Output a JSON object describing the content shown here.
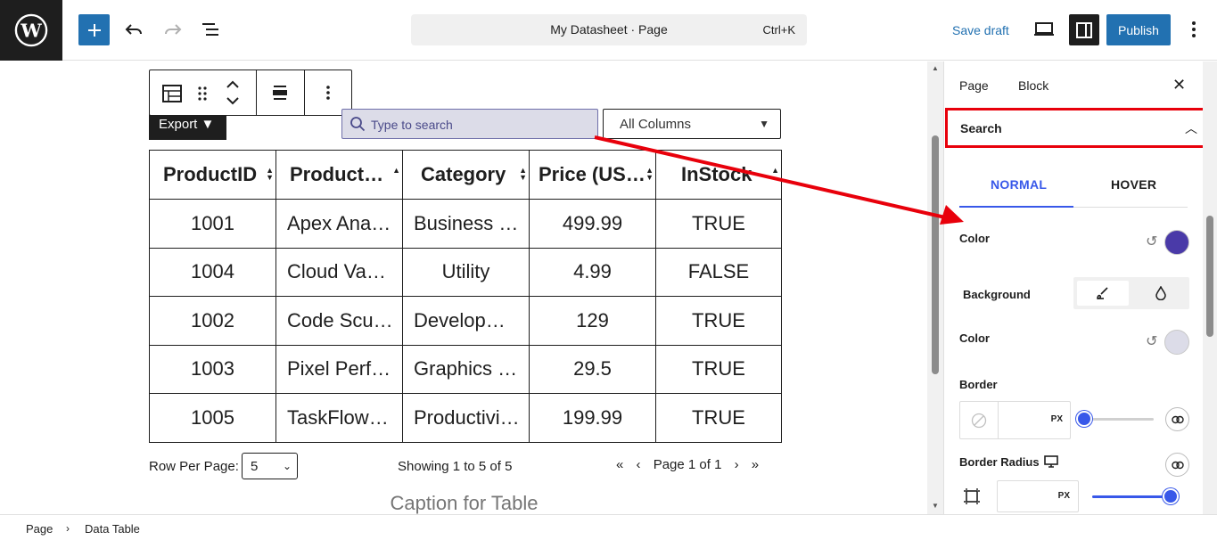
{
  "topbar": {
    "doc_title": "My Datasheet · Page",
    "shortcut": "Ctrl+K",
    "save_draft": "Save draft",
    "publish": "Publish"
  },
  "table_controls": {
    "export_label": "Export",
    "search_placeholder": "Type to search",
    "columns_select": "All Columns"
  },
  "table": {
    "headers": [
      "ProductID",
      "Product…",
      "Category",
      "Price (US…",
      "InStock"
    ],
    "rows": [
      [
        "1001",
        "Apex Anal…",
        "Business I…",
        "499.99",
        "TRUE"
      ],
      [
        "1004",
        "Cloud Vau…",
        "Utility",
        "4.99",
        "FALSE"
      ],
      [
        "1002",
        "Code Scul…",
        "Developm…",
        "129",
        "TRUE"
      ],
      [
        "1003",
        "Pixel Perf…",
        "Graphics …",
        "29.5",
        "TRUE"
      ],
      [
        "1005",
        "TaskFlow …",
        "Productivi…",
        "199.99",
        "TRUE"
      ]
    ]
  },
  "pagination": {
    "rows_per_page_label": "Row Per Page:",
    "rows_per_page_value": "5",
    "showing": "Showing 1 to 5 of 5",
    "page_label": "Page 1 of 1"
  },
  "caption": "Caption for Table",
  "breadcrumb": [
    "Page",
    "Data Table"
  ],
  "panel": {
    "tabs": [
      "Page",
      "Block"
    ],
    "section_title": "Search",
    "state_tabs": [
      "NORMAL",
      "HOVER"
    ],
    "color_label": "Color",
    "background_label": "Background",
    "bg_color_label": "Color",
    "border_label": "Border",
    "border_unit": "PX",
    "border_radius_label": "Border Radius",
    "radius_unit": "PX",
    "text_color": "#4a3aa8",
    "bg_color": "#dcdce8",
    "border_width_fraction": 0,
    "radius_fraction": 1
  },
  "colors": {
    "accent": "#2271b1",
    "tab_accent": "#3858e9",
    "highlight": "#e8000b"
  }
}
